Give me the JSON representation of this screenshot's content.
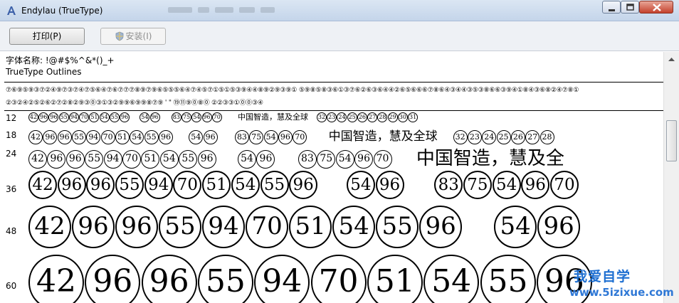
{
  "window": {
    "title": "Endylau (TrueType)",
    "minimize_label": "minimize",
    "maximize_label": "maximize",
    "close_label": "close"
  },
  "toolbar": {
    "print_label": "打印(P)",
    "install_label": "安装(I)"
  },
  "font_info": {
    "name_line": "字体名称: !@#$%^&*()_+",
    "outline_type": "TrueType Outlines"
  },
  "charset_rows": [
    "⑦⑥⑨⑤⑨③⑦②④⑨⑦③⑦④⑦⑤⑥④⑦⑥⑦⑦⑦⑧⑨⑦⑨⑥⑤⑤⑤⑥④⑦④⑤⑦①⑤①⑤③⑨④④⑧⑨②⑨③⑨①     ⑤⑨⑧⑤⑧③⑥①③⑦⑥②⑥③⑥④④②⑥⑤⑥⑥⑥⑦⑧⑥④③④④③⑤③⑧⑥⑥③⑨④①⑧④③⑥⑧②④⑦⑧①",
    "②③②④②⑤②⑥②⑦②⑧②⑨③⓪③①③②⑨⑨⑥⑨⑨⑧⑦⑨   '   \"   ⑲⑪⑨⓪⑧⓪   ②②③③①⓪⓪③④"
  ],
  "size_rows": [
    {
      "label": "12",
      "glyphs_a": [
        "42",
        "96",
        "96",
        "55",
        "94",
        "70",
        "51",
        "54",
        "55",
        "96"
      ],
      "glyphs_b": [
        "54",
        "96"
      ],
      "glyphs_c": [
        "83",
        "75",
        "54",
        "96",
        "70"
      ],
      "text": "中国智造，慧及全球",
      "glyphs_d": [
        "32",
        "23",
        "24",
        "25",
        "26",
        "27",
        "28",
        "29",
        "30",
        "31"
      ]
    },
    {
      "label": "18",
      "glyphs_a": [
        "42",
        "96",
        "96",
        "55",
        "94",
        "70",
        "51",
        "54",
        "55",
        "96"
      ],
      "glyphs_b": [
        "54",
        "96"
      ],
      "glyphs_c": [
        "83",
        "75",
        "54",
        "96",
        "70"
      ],
      "text": "中国智造，慧及全球",
      "glyphs_d": [
        "32",
        "23",
        "24",
        "25",
        "26",
        "27",
        "28"
      ]
    },
    {
      "label": "24",
      "glyphs_a": [
        "42",
        "96",
        "96",
        "55",
        "94",
        "70",
        "51",
        "54",
        "55",
        "96"
      ],
      "glyphs_b": [
        "54",
        "96"
      ],
      "glyphs_c": [
        "83",
        "75",
        "54",
        "96",
        "70"
      ],
      "text": "中国智造，慧及全"
    },
    {
      "label": "36",
      "glyphs_a": [
        "42",
        "96",
        "96",
        "55",
        "94",
        "70",
        "51",
        "54",
        "55",
        "96"
      ],
      "glyphs_b": [
        "54",
        "96"
      ],
      "glyphs_c": [
        "83",
        "75",
        "54",
        "96",
        "70"
      ]
    },
    {
      "label": "48",
      "glyphs_a": [
        "42",
        "96",
        "96",
        "55",
        "94",
        "70",
        "51",
        "54",
        "55",
        "96"
      ],
      "glyphs_b": [
        "54",
        "96"
      ]
    },
    {
      "label": "60",
      "glyphs_a": [
        "42",
        "96",
        "96",
        "55",
        "94",
        "70",
        "51",
        "54",
        "55",
        "96"
      ]
    }
  ],
  "watermark": {
    "cn": "我爱自学",
    "url": "www.5izixue.com"
  },
  "colors": {
    "titlebar": "#c4d5ea",
    "watermark": "#1e6fd1",
    "close_button": "#c4412c"
  }
}
